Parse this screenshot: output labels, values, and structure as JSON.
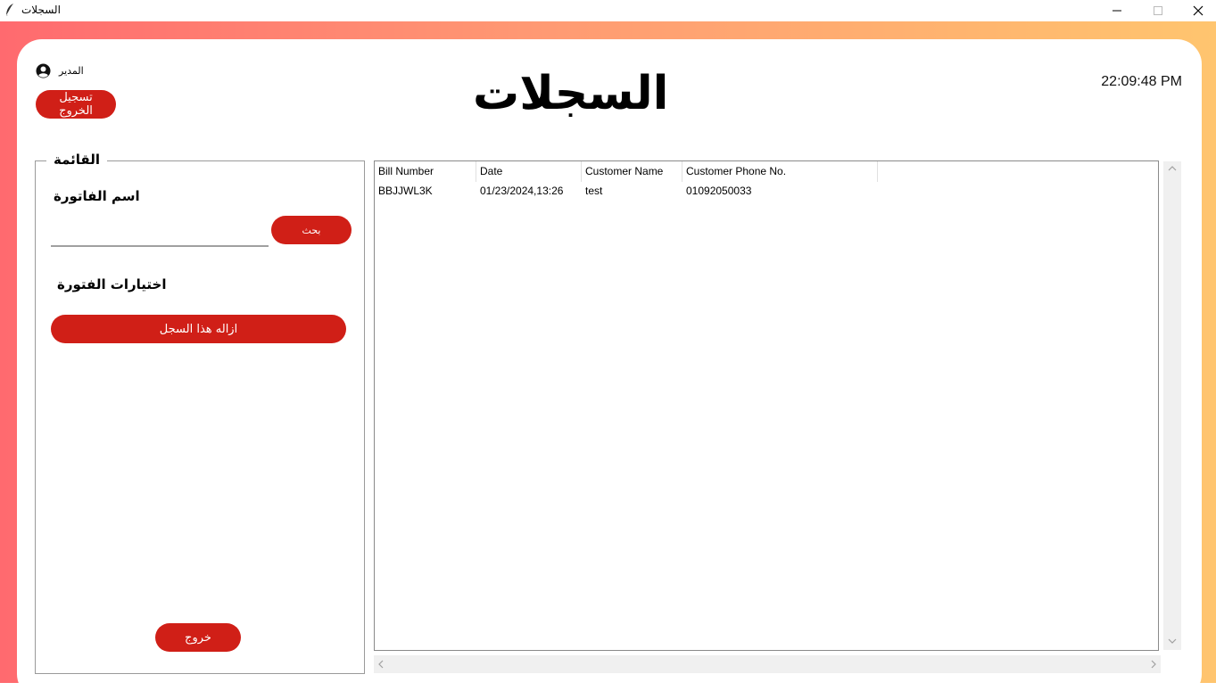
{
  "window": {
    "title": "السجلات",
    "minimize_glyph": "—",
    "maximize_glyph": "☐",
    "close_glyph": "✕",
    "icon": "feather-icon"
  },
  "header": {
    "user_label": "المدير",
    "user_icon": "user-circle-icon",
    "logout_label": "تسجيل الخروج",
    "page_title": "السجلات",
    "clock": "22:09:48 PM"
  },
  "menu": {
    "legend": "القائمة",
    "bill_name_label": "اسم الفاتورة",
    "search_value": "",
    "search_button": "بحث",
    "options_label": "اختيارات الفتورة",
    "remove_button": "ازاله هذا السجل",
    "exit_button": "خروج"
  },
  "table": {
    "columns": [
      "Bill Number",
      "Date",
      "Customer Name",
      "Customer Phone No."
    ],
    "rows": [
      [
        "BBJJWL3K",
        "01/23/2024,13:26",
        "test",
        "01092050033"
      ]
    ]
  },
  "colors": {
    "accent": "#d01f17",
    "gradient_start": "#ff6a6f",
    "gradient_end": "#ffc56f"
  }
}
